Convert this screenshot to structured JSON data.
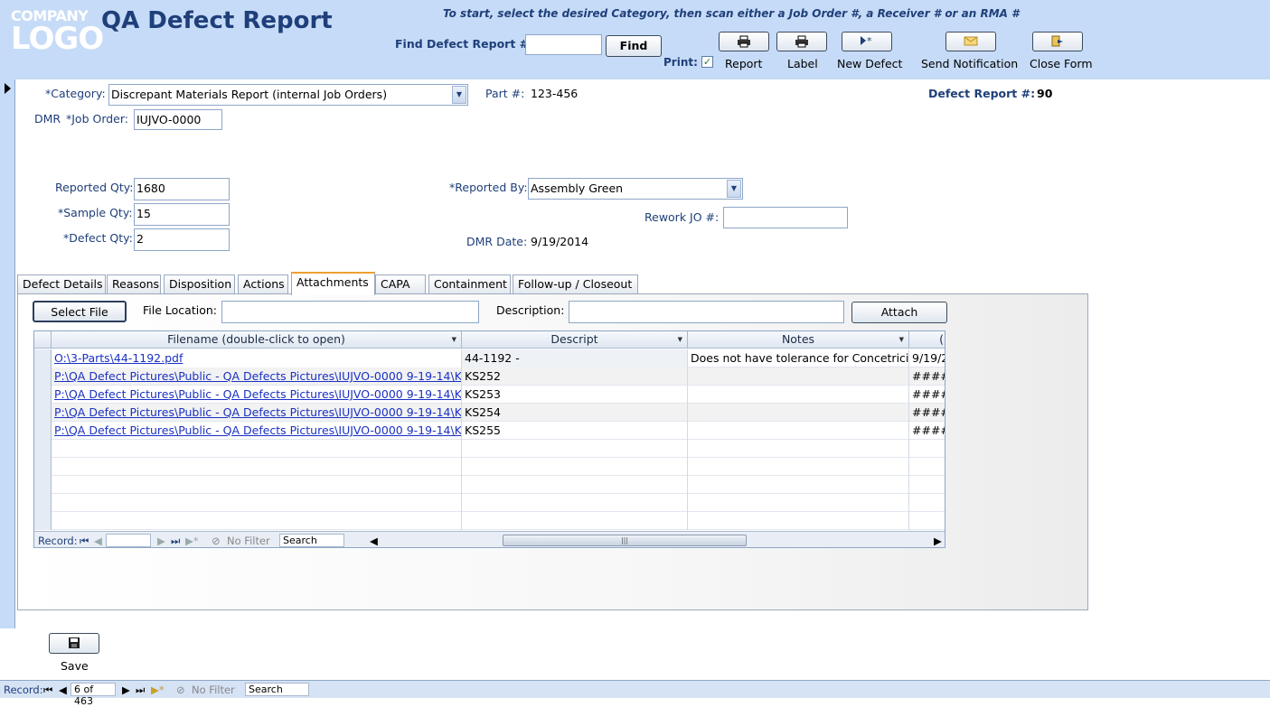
{
  "header": {
    "logo_line1": "COMPANY",
    "logo_line2": "LOGO",
    "title": "QA Defect Report",
    "instructions": "To start, select the desired Category, then scan either a Job Order #, a Receiver # or an RMA #",
    "find_label": "Find Defect Report #:",
    "find_value": "",
    "find_button": "Find",
    "print_label": "Print:",
    "print_checked": true,
    "toolbar": [
      {
        "label": "Report",
        "icon": "printer-icon"
      },
      {
        "label": "Label",
        "icon": "printer-icon"
      },
      {
        "label": "New Defect",
        "icon": "new-record-icon"
      },
      {
        "label": "Send Notification",
        "icon": "envelope-icon"
      },
      {
        "label": "Close Form",
        "icon": "close-form-icon"
      }
    ]
  },
  "form": {
    "category_label": "*Category:",
    "category_value": "Discrepant Materials Report (internal Job Orders)",
    "part_label": "Part #:",
    "part_value": "123-456",
    "defect_report_label": "Defect Report #:",
    "defect_report_value": "90",
    "dmr_label": "DMR",
    "job_order_label": "*Job Order:",
    "job_order_value": "IUJVO-0000",
    "reported_qty_label": "Reported Qty:",
    "reported_qty_value": "1680",
    "sample_qty_label": "*Sample Qty:",
    "sample_qty_value": "15",
    "defect_qty_label": "*Defect Qty:",
    "defect_qty_value": "2",
    "reported_by_label": "*Reported By:",
    "reported_by_value": "Assembly Green",
    "rework_jo_label": "Rework JO #:",
    "rework_jo_value": "",
    "dmr_date_label": "DMR Date:",
    "dmr_date_value": "9/19/2014"
  },
  "tabs": [
    {
      "label": "Defect Details"
    },
    {
      "label": "Reasons"
    },
    {
      "label": "Disposition"
    },
    {
      "label": "Actions"
    },
    {
      "label": "Attachments",
      "active": true
    },
    {
      "label": "CAPA"
    },
    {
      "label": "Containment"
    },
    {
      "label": "Follow-up / Closeout"
    }
  ],
  "attachments": {
    "select_file_button": "Select File",
    "file_location_label": "File Location:",
    "file_location_value": "",
    "description_label": "Description:",
    "description_value": "",
    "attach_button": "Attach",
    "columns": [
      "Filename (double-click to open)",
      "Descript",
      "Notes",
      "("
    ],
    "rows": [
      [
        "O:\\3-Parts\\44-1192.pdf",
        "44-1192 -",
        "Does not have tolerance for Concetricit",
        "9/19/2"
      ],
      [
        "P:\\QA Defect Pictures\\Public - QA Defects Pictures\\IUJVO-0000 9-19-14\\K",
        "KS252",
        "",
        "#####"
      ],
      [
        "P:\\QA Defect Pictures\\Public - QA Defects Pictures\\IUJVO-0000 9-19-14\\K",
        "KS253",
        "",
        "#####"
      ],
      [
        "P:\\QA Defect Pictures\\Public - QA Defects Pictures\\IUJVO-0000 9-19-14\\K",
        "KS254",
        "",
        "#####"
      ],
      [
        "P:\\QA Defect Pictures\\Public - QA Defects Pictures\\IUJVO-0000 9-19-14\\K",
        "KS255",
        "",
        "#####"
      ]
    ],
    "nav": {
      "record_label": "Record:",
      "record_value": "",
      "filter_label": "No Filter",
      "search_label": "Search"
    }
  },
  "footer": {
    "save_label": "Save",
    "record_label": "Record:",
    "record_value": "6 of 463",
    "filter_label": "No Filter",
    "search_label": "Search"
  }
}
